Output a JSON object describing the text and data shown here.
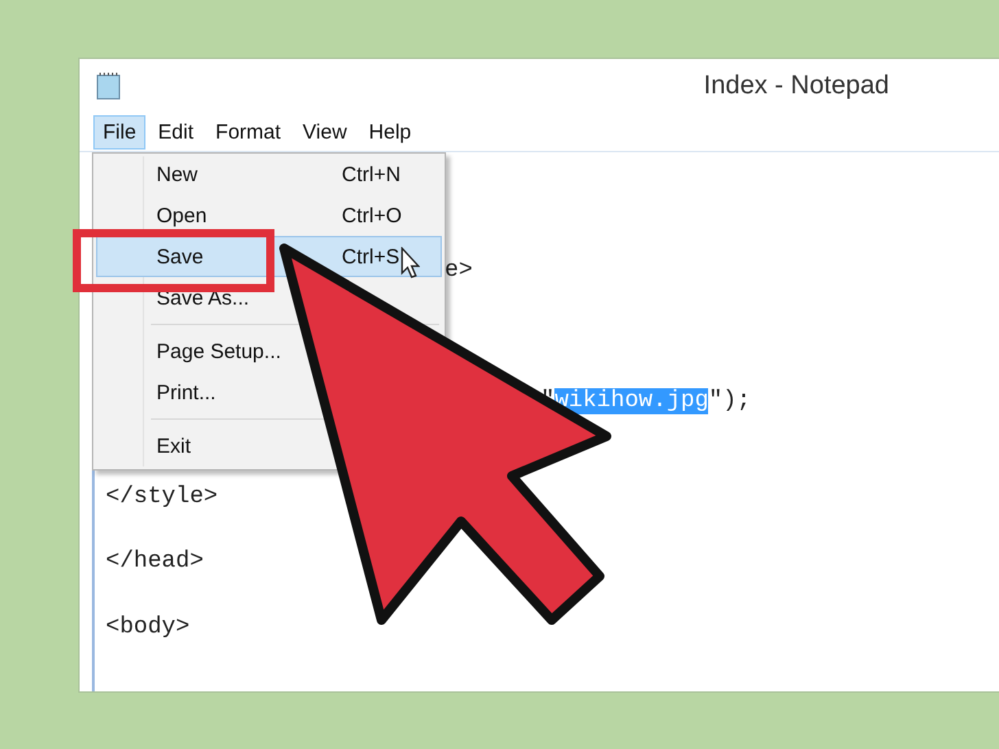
{
  "window": {
    "title": "Index - Notepad"
  },
  "menu_bar": [
    {
      "label": "File",
      "selected": true
    },
    {
      "label": "Edit",
      "selected": false
    },
    {
      "label": "Format",
      "selected": false
    },
    {
      "label": "View",
      "selected": false
    },
    {
      "label": "Help",
      "selected": false
    }
  ],
  "file_menu": {
    "groups": [
      [
        {
          "label": "New",
          "shortcut": "Ctrl+N",
          "selected": false
        },
        {
          "label": "Open",
          "shortcut": "Ctrl+O",
          "selected": false
        },
        {
          "label": "Save",
          "shortcut": "Ctrl+S",
          "selected": true
        },
        {
          "label": "Save As...",
          "selected": false
        }
      ],
      [
        {
          "label": "Page Setup...",
          "selected": false
        },
        {
          "label": "Print...",
          "selected": false
        }
      ],
      [
        {
          "label": "Exit",
          "selected": false
        }
      ]
    ]
  },
  "editor": {
    "lines": [
      {
        "kind": "fragment",
        "text": "e>"
      },
      {
        "kind": "fragment",
        "before": "\"",
        "selection": "wikihow.jpg",
        "after": "\");"
      },
      {
        "kind": "line",
        "text": "</style>"
      },
      {
        "kind": "line",
        "text": "</head>"
      },
      {
        "kind": "line",
        "text": "<body>"
      }
    ]
  }
}
